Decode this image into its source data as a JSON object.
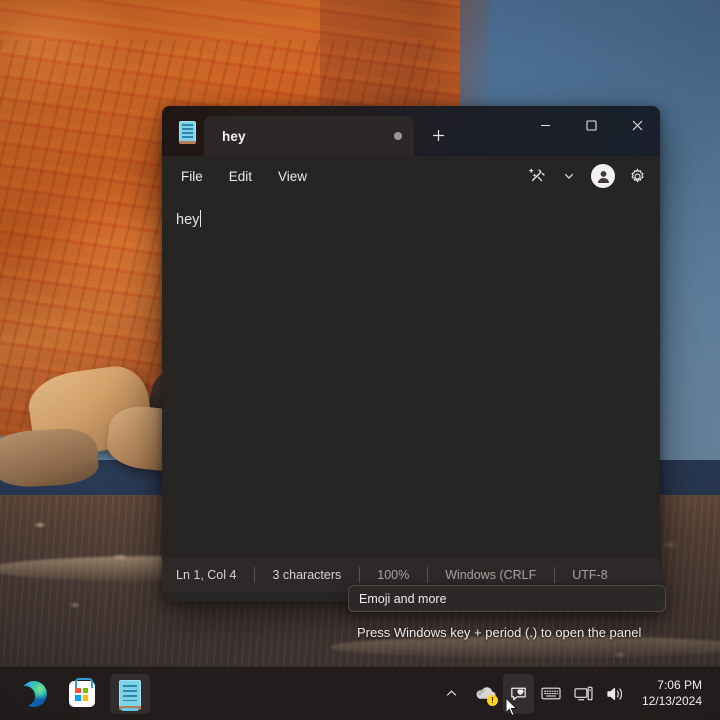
{
  "desktop": {
    "wallpaper_description": "Orange sandstone rock formation with blue sky",
    "accent_color": "#64c6e8"
  },
  "window": {
    "app_icon": "notepad-icon",
    "tab": {
      "title": "hey",
      "unsaved_indicator": "modified-dot"
    },
    "new_tab_label": "+",
    "controls": {
      "minimize": "minimize-icon",
      "maximize": "maximize-icon",
      "close": "close-icon"
    },
    "menu": [
      {
        "label": "File",
        "name": "menu-file"
      },
      {
        "label": "Edit",
        "name": "menu-edit"
      },
      {
        "label": "View",
        "name": "menu-view"
      }
    ],
    "toolbar": {
      "rewrite_icon": "magic-wand-sparkle-icon",
      "chevron_icon": "chevron-down-icon",
      "account_icon": "account-avatar-icon",
      "settings_icon": "gear-icon"
    },
    "editor": {
      "text": "hey"
    },
    "status_bar": {
      "cursor_position": "Ln 1, Col 4",
      "char_count": "3 characters",
      "zoom": "100%",
      "line_ending": "Windows (CRLF",
      "encoding": "UTF-8"
    }
  },
  "tooltip": {
    "title": "Emoji and more",
    "hint": "Press Windows key + period (.) to open the panel"
  },
  "taskbar": {
    "apps": [
      {
        "label": "Microsoft Edge",
        "name": "taskbar-edge",
        "icon": "edge-icon"
      },
      {
        "label": "Microsoft Store",
        "name": "taskbar-store",
        "icon": "store-icon"
      },
      {
        "label": "Notepad",
        "name": "taskbar-notepad",
        "icon": "notepad-icon"
      }
    ],
    "tray": {
      "overflow_icon": "chevron-up-icon",
      "onedrive_icon": "onedrive-cloud-icon",
      "onedrive_badge": "!",
      "emoji_panel_icon": "emoji-heart-icon",
      "keyboard_icon": "touch-keyboard-icon",
      "network_icon": "network-icon",
      "volume_icon": "volume-icon"
    },
    "clock": {
      "time": "7:06 PM",
      "date": "12/13/2024"
    }
  }
}
